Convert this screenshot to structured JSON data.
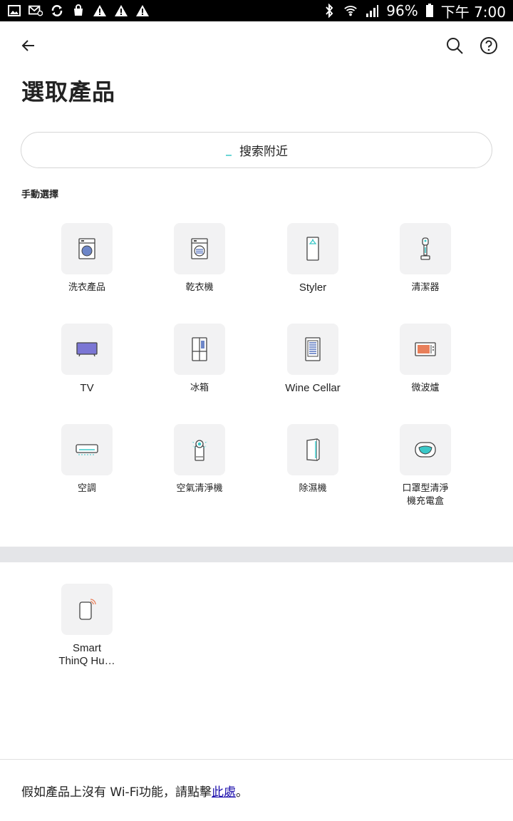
{
  "status_bar": {
    "battery_percent": "96%",
    "time": "下午 7:00",
    "left_icons": [
      "gallery-icon",
      "mail-icon",
      "sync-icon",
      "bag-icon",
      "warning-icon",
      "warning-icon",
      "warning-icon"
    ],
    "right_icons": [
      "bluetooth-icon",
      "wifi-icon",
      "signal-icon",
      "battery-icon"
    ]
  },
  "header": {
    "back_icon": "back-arrow-icon",
    "search_icon": "search-icon",
    "help_icon": "help-icon"
  },
  "page_title": "選取產品",
  "nearby": {
    "label": "搜索附近"
  },
  "manual_section": {
    "label": "手動選擇",
    "products": [
      {
        "label": "洗衣產品",
        "icon": "washer-icon"
      },
      {
        "label": "乾衣機",
        "icon": "dryer-icon"
      },
      {
        "label": "Styler",
        "icon": "styler-icon"
      },
      {
        "label": "清潔器",
        "icon": "vacuum-icon"
      },
      {
        "label": "TV",
        "icon": "tv-icon"
      },
      {
        "label": "冰箱",
        "icon": "refrigerator-icon"
      },
      {
        "label": "Wine Cellar",
        "icon": "wine-cellar-icon"
      },
      {
        "label": "微波爐",
        "icon": "microwave-icon"
      },
      {
        "label": "空調",
        "icon": "air-conditioner-icon"
      },
      {
        "label": "空氣清淨機",
        "icon": "air-purifier-icon"
      },
      {
        "label": "除濕機",
        "icon": "dehumidifier-icon"
      },
      {
        "label": "口罩型清淨機充電盒",
        "icon": "mask-purifier-case-icon"
      }
    ]
  },
  "other_section": {
    "products": [
      {
        "label": "Smart ThinQ Hu…",
        "icon": "smart-thinq-hub-icon"
      }
    ]
  },
  "footer": {
    "prefix": "假如產品上沒有 Wi-Fi功能，請點擊",
    "link": "此處",
    "suffix": "。"
  },
  "colors": {
    "tile_bg": "#f2f2f3",
    "accent_teal": "#3ac8c8",
    "icon_blue": "#6d86c8",
    "tv_purple": "#7b76d4",
    "microwave_orange": "#e87f5a",
    "link_blue": "#1a0dab",
    "divider_band": "#e4e5e8"
  }
}
